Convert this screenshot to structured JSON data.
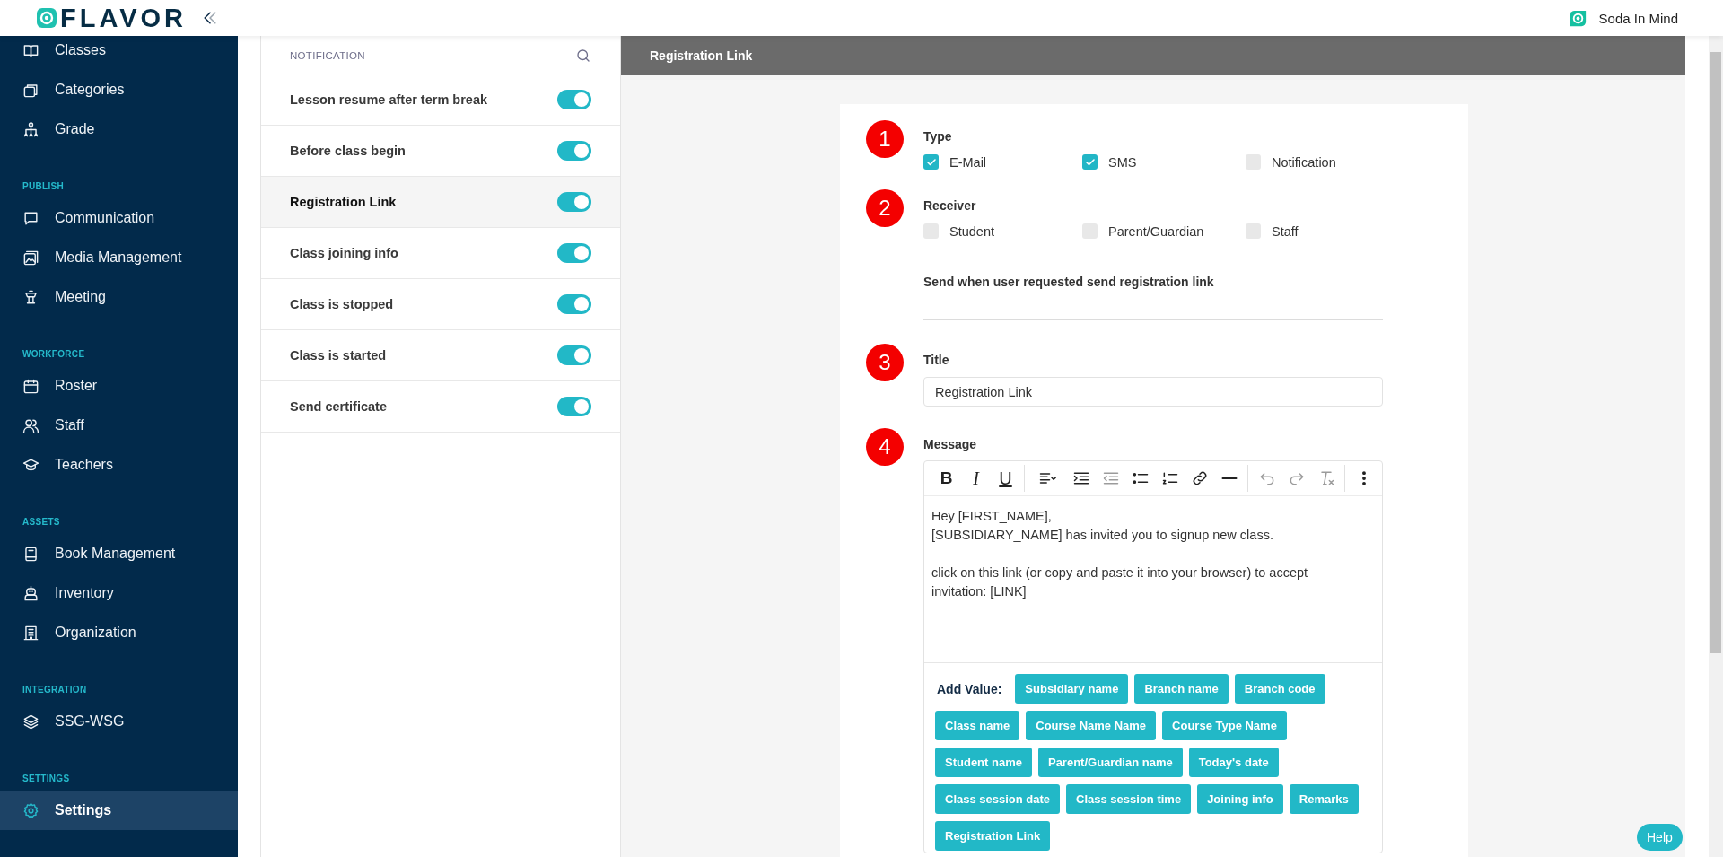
{
  "header": {
    "brand": "FLAVOR",
    "account": "Soda In Mind"
  },
  "sidebar": {
    "sections": [
      {
        "items": [
          {
            "label": "Classes",
            "selected": false
          },
          {
            "label": "Categories",
            "selected": false
          },
          {
            "label": "Grade",
            "selected": false
          }
        ]
      },
      {
        "heading": "PUBLISH",
        "items": [
          {
            "label": "Communication",
            "selected": false
          },
          {
            "label": "Media Management",
            "selected": false
          },
          {
            "label": "Meeting",
            "selected": false
          }
        ]
      },
      {
        "heading": "WORKFORCE",
        "items": [
          {
            "label": "Roster",
            "selected": false
          },
          {
            "label": "Staff",
            "selected": false
          },
          {
            "label": "Teachers",
            "selected": false
          }
        ]
      },
      {
        "heading": "ASSETS",
        "items": [
          {
            "label": "Book Management",
            "selected": false
          },
          {
            "label": "Inventory",
            "selected": false
          },
          {
            "label": "Organization",
            "selected": false
          }
        ]
      },
      {
        "heading": "INTEGRATION",
        "items": [
          {
            "label": "SSG-WSG",
            "selected": false
          }
        ]
      },
      {
        "heading": "SETTINGS",
        "items": [
          {
            "label": "Settings",
            "selected": true
          }
        ]
      }
    ]
  },
  "notifications": {
    "heading": "NOTIFICATION",
    "items": [
      {
        "label": "Lesson resume after term break",
        "on": true,
        "selected": false
      },
      {
        "label": "Before class begin",
        "on": true,
        "selected": false
      },
      {
        "label": "Registration Link",
        "on": true,
        "selected": true
      },
      {
        "label": "Class joining info",
        "on": true,
        "selected": false
      },
      {
        "label": "Class is stopped",
        "on": true,
        "selected": false
      },
      {
        "label": "Class is started",
        "on": true,
        "selected": false
      },
      {
        "label": "Send certificate",
        "on": true,
        "selected": false
      }
    ]
  },
  "detail": {
    "title": "Registration Link",
    "type_group": {
      "step": "1",
      "label": "Type",
      "options": [
        {
          "label": "E-Mail",
          "checked": true
        },
        {
          "label": "SMS",
          "checked": true
        },
        {
          "label": "Notification",
          "checked": false
        }
      ]
    },
    "receiver_group": {
      "step": "2",
      "label": "Receiver",
      "options": [
        {
          "label": "Student",
          "checked": false
        },
        {
          "label": "Parent/Guardian",
          "checked": false
        },
        {
          "label": "Staff",
          "checked": false
        }
      ]
    },
    "trigger_note": "Send when user requested send registration link",
    "title_field": {
      "step": "3",
      "label": "Title",
      "value": "Registration Link"
    },
    "message": {
      "step": "4",
      "label": "Message",
      "toolbar": [
        {
          "kind": "bold",
          "label": "B",
          "disabled": false
        },
        {
          "kind": "italic",
          "label": "I",
          "disabled": false
        },
        {
          "kind": "underline",
          "label": "U",
          "disabled": false
        },
        {
          "kind": "separator"
        },
        {
          "kind": "align",
          "disabled": false
        },
        {
          "kind": "indent",
          "disabled": false
        },
        {
          "kind": "outdent",
          "disabled": true
        },
        {
          "kind": "bullets",
          "disabled": false
        },
        {
          "kind": "numbers",
          "disabled": false
        },
        {
          "kind": "link",
          "disabled": false
        },
        {
          "kind": "rule",
          "disabled": false
        },
        {
          "kind": "separator"
        },
        {
          "kind": "undo",
          "disabled": true
        },
        {
          "kind": "redo",
          "disabled": true
        },
        {
          "kind": "clear",
          "disabled": true
        },
        {
          "kind": "separator"
        },
        {
          "kind": "more",
          "disabled": false
        }
      ],
      "paragraphs": [
        [
          "Hey [FIRST_NAME],",
          "[SUBSIDIARY_NAME] has invited you to signup new class."
        ],
        [
          "click on this link (or copy and paste it into your browser) to accept",
          "invitation: [LINK]"
        ]
      ],
      "add_value_label": "Add Value:",
      "values": [
        "Subsidiary name",
        "Branch name",
        "Branch code",
        "Class name",
        "Course Name Name",
        "Course Type Name",
        "Student name",
        "Parent/Guardian name",
        "Today's date",
        "Class session date",
        "Class session time",
        "Joining info",
        "Remarks",
        "Registration Link"
      ]
    }
  },
  "help": "Help"
}
